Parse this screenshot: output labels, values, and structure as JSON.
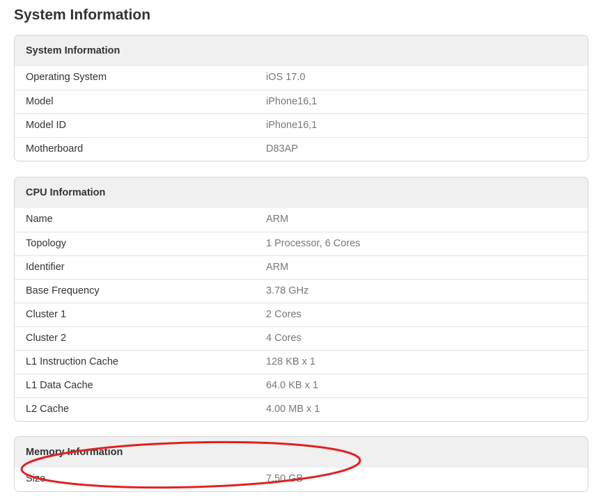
{
  "page": {
    "title": "System Information"
  },
  "sections": [
    {
      "title": "System Information",
      "rows": [
        {
          "label": "Operating System",
          "value": "iOS 17.0"
        },
        {
          "label": "Model",
          "value": "iPhone16,1"
        },
        {
          "label": "Model ID",
          "value": "iPhone16,1"
        },
        {
          "label": "Motherboard",
          "value": "D83AP"
        }
      ]
    },
    {
      "title": "CPU Information",
      "rows": [
        {
          "label": "Name",
          "value": "ARM"
        },
        {
          "label": "Topology",
          "value": "1 Processor, 6 Cores"
        },
        {
          "label": "Identifier",
          "value": "ARM"
        },
        {
          "label": "Base Frequency",
          "value": "3.78 GHz"
        },
        {
          "label": "Cluster 1",
          "value": "2 Cores"
        },
        {
          "label": "Cluster 2",
          "value": "4 Cores"
        },
        {
          "label": "L1 Instruction Cache",
          "value": "128 KB x 1"
        },
        {
          "label": "L1 Data Cache",
          "value": "64.0 KB x 1"
        },
        {
          "label": "L2 Cache",
          "value": "4.00 MB x 1"
        }
      ]
    },
    {
      "title": "Memory Information",
      "rows": [
        {
          "label": "Size",
          "value": "7.50 GB"
        }
      ]
    }
  ],
  "annotation": {
    "color": "#e02020"
  }
}
